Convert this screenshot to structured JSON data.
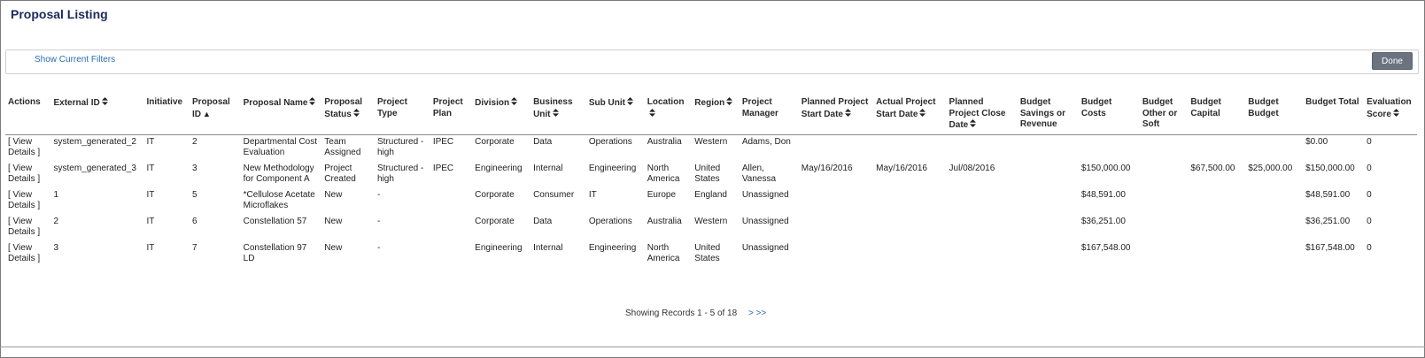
{
  "title": "Proposal Listing",
  "filters": {
    "show_label": "Show Current Filters",
    "done_label": "Done"
  },
  "columns": [
    {
      "label": "Actions",
      "sort": ""
    },
    {
      "label": "External ID",
      "sort": "both"
    },
    {
      "label": "Initiative",
      "sort": ""
    },
    {
      "label": "Proposal ID",
      "sort": "asc"
    },
    {
      "label": "Proposal Name",
      "sort": "both"
    },
    {
      "label": "Proposal Status",
      "sort": "both"
    },
    {
      "label": "Project Type",
      "sort": ""
    },
    {
      "label": "Project Plan",
      "sort": ""
    },
    {
      "label": "Division",
      "sort": "both"
    },
    {
      "label": "Business Unit",
      "sort": "both"
    },
    {
      "label": "Sub Unit",
      "sort": "both"
    },
    {
      "label": "Location",
      "sort": "both"
    },
    {
      "label": "Region",
      "sort": "both"
    },
    {
      "label": "Project Manager",
      "sort": ""
    },
    {
      "label": "Planned Project Start Date",
      "sort": "both"
    },
    {
      "label": "Actual Project Start Date",
      "sort": "both"
    },
    {
      "label": "Planned Project Close Date",
      "sort": "both"
    },
    {
      "label": "Budget Savings or Revenue",
      "sort": ""
    },
    {
      "label": "Budget Costs",
      "sort": ""
    },
    {
      "label": "Budget Other or Soft",
      "sort": ""
    },
    {
      "label": "Budget Capital",
      "sort": ""
    },
    {
      "label": "Budget Budget",
      "sort": ""
    },
    {
      "label": "Budget Total",
      "sort": ""
    },
    {
      "label": "Evaluation Score",
      "sort": "both"
    }
  ],
  "rows": [
    {
      "action": "[ View Details ]",
      "cells": [
        "system_generated_2",
        "IT",
        "2",
        "Departmental Cost Evaluation",
        "Team Assigned",
        "Structured - high",
        "IPEC",
        "Corporate",
        "Data",
        "Operations",
        "Australia",
        "Western",
        "Adams, Don",
        "",
        "",
        "",
        "",
        "",
        "",
        "",
        "",
        "$0.00",
        "0"
      ]
    },
    {
      "action": "[ View Details ]",
      "cells": [
        "system_generated_3",
        "IT",
        "3",
        "New Methodology for Component A",
        "Project Created",
        "Structured - high",
        "IPEC",
        "Engineering",
        "Internal",
        "Engineering",
        "North America",
        "United States",
        "Allen, Vanessa",
        "May/16/2016",
        "May/16/2016",
        "Jul/08/2016",
        "",
        "$150,000.00",
        "",
        "$67,500.00",
        "$25,000.00",
        "$150,000.00",
        "0"
      ]
    },
    {
      "action": "[ View Details ]",
      "cells": [
        "1",
        "IT",
        "5",
        "*Cellulose Acetate Microflakes",
        "New",
        "-",
        "",
        "Corporate",
        "Consumer",
        "IT",
        "Europe",
        "England",
        "Unassigned",
        "",
        "",
        "",
        "",
        "$48,591.00",
        "",
        "",
        "",
        "$48,591.00",
        "0"
      ]
    },
    {
      "action": "[ View Details ]",
      "cells": [
        "2",
        "IT",
        "6",
        "Constellation 57",
        "New",
        "-",
        "",
        "Corporate",
        "Data",
        "Operations",
        "Australia",
        "Western",
        "Unassigned",
        "",
        "",
        "",
        "",
        "$36,251.00",
        "",
        "",
        "",
        "$36,251.00",
        "0"
      ]
    },
    {
      "action": "[ View Details ]",
      "cells": [
        "3",
        "IT",
        "7",
        "Constellation 97 LD",
        "New",
        "-",
        "",
        "Engineering",
        "Internal",
        "Engineering",
        "North America",
        "United States",
        "Unassigned",
        "",
        "",
        "",
        "",
        "$167,548.00",
        "",
        "",
        "",
        "$167,548.00",
        "0"
      ]
    }
  ],
  "pagination": {
    "summary": "Showing Records 1 - 5 of 18",
    "next_label": "> >>"
  },
  "colors": {
    "link": "#2a6db5",
    "title": "#1b2a5a",
    "done_button": "#6b7380"
  },
  "icons": {
    "sort_both": "sort-both-icon",
    "sort_asc": "sort-ascending-icon"
  }
}
